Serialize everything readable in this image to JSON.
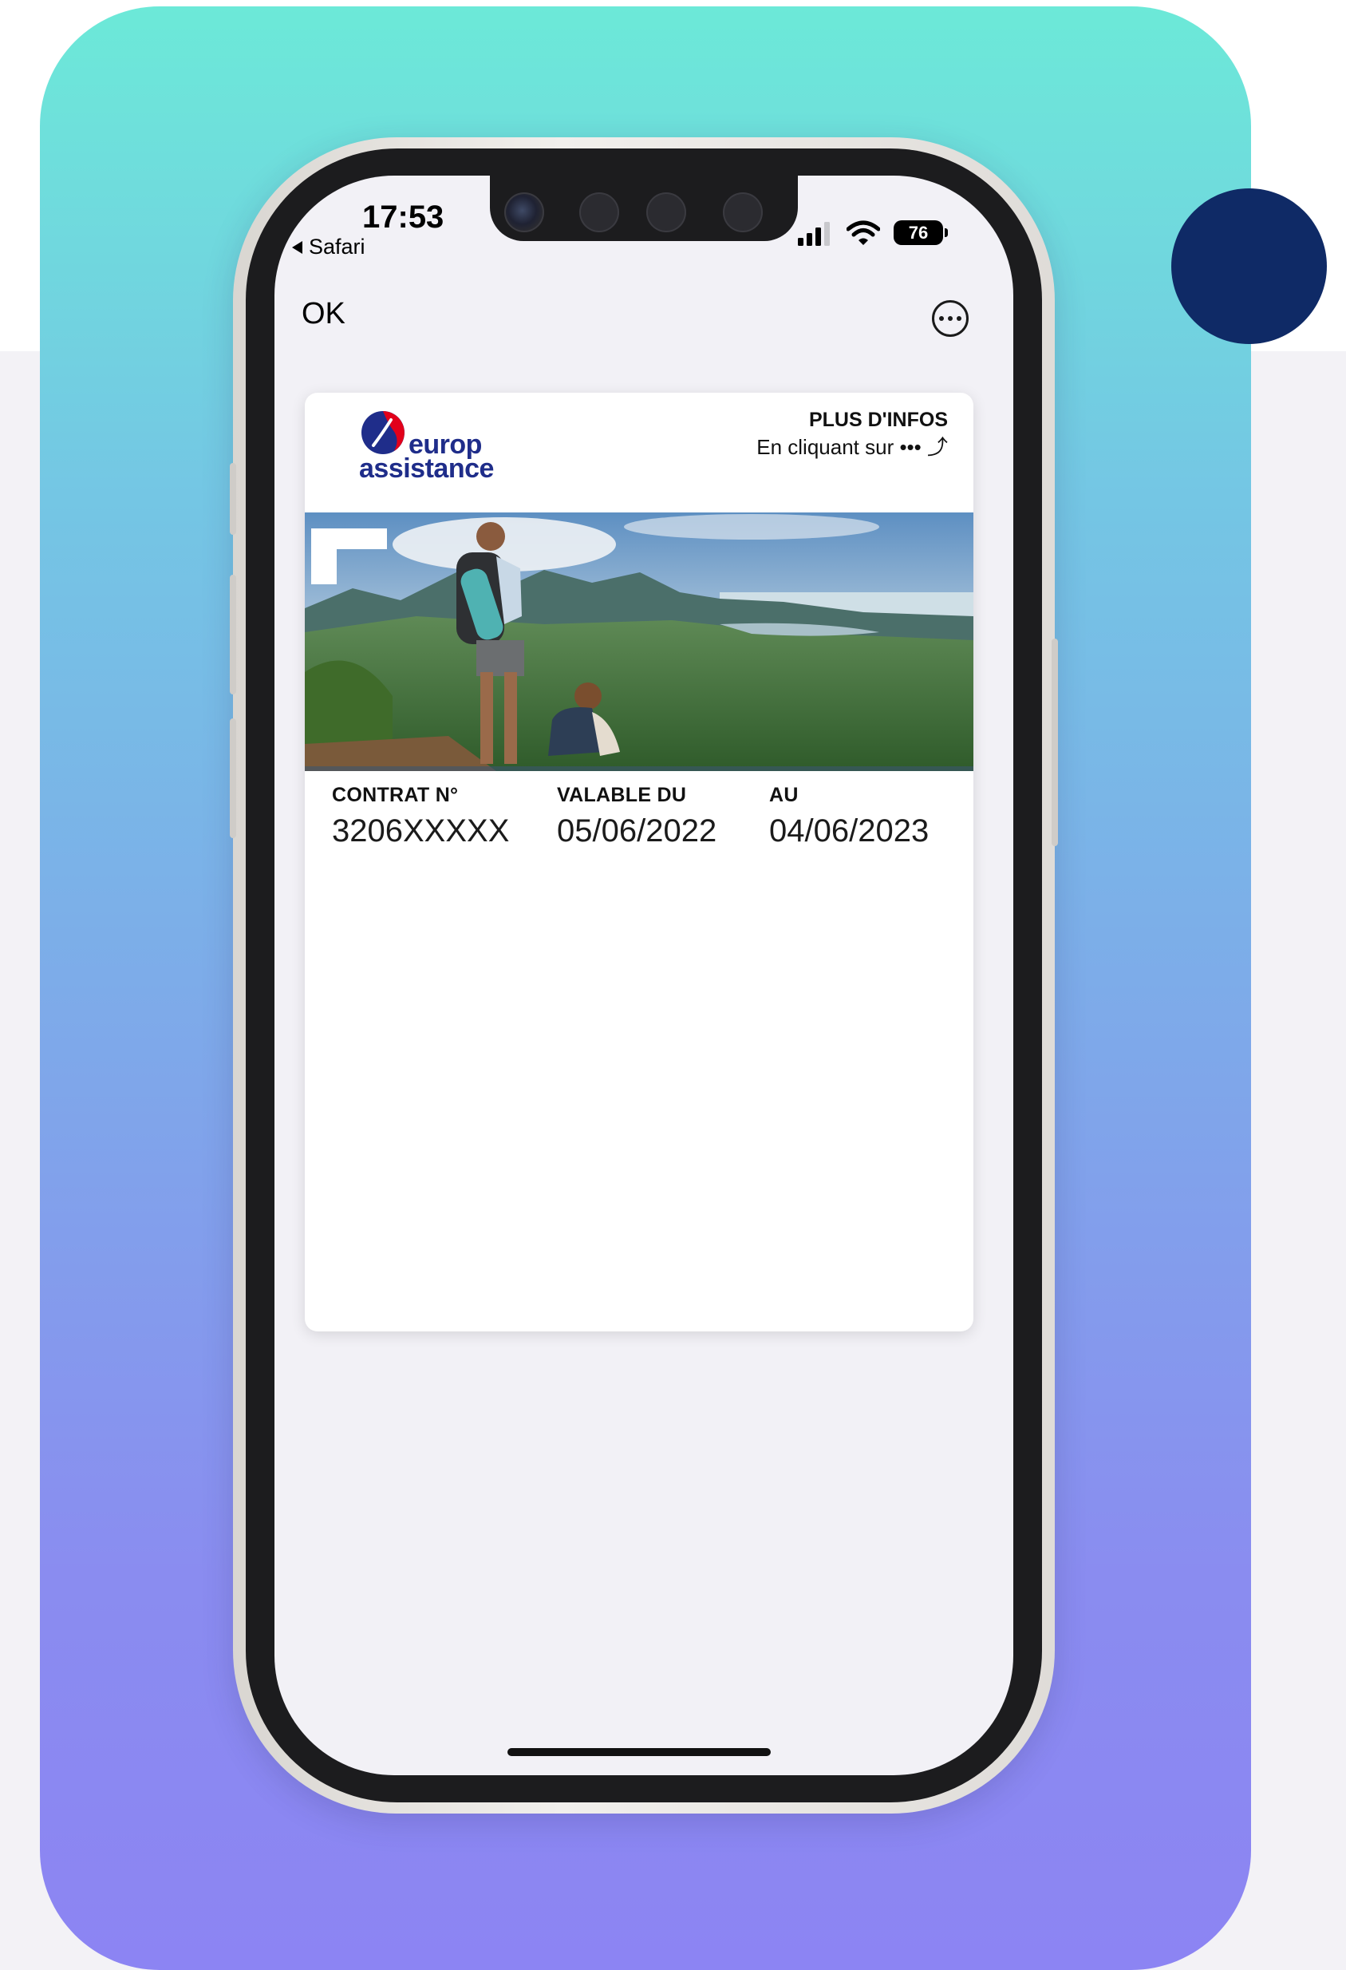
{
  "status_bar": {
    "time": "17:53",
    "back_app": "Safari",
    "battery": "76"
  },
  "nav": {
    "ok_label": "OK"
  },
  "pass": {
    "brand_line1": "europ",
    "brand_line2": "assistance",
    "info_title": "PLUS D'INFOS",
    "info_subtitle": "En cliquant sur ••• ⤴",
    "fields": [
      {
        "label": "CONTRAT N°",
        "value": "3206XXXXX"
      },
      {
        "label": "VALABLE DU",
        "value": "05/06/2022"
      },
      {
        "label": "AU",
        "value": "04/06/2023"
      }
    ]
  },
  "colors": {
    "brand_navy": "#1f2d8a",
    "brand_red": "#e2001a",
    "gradient_top": "#6ce9d8",
    "gradient_bottom": "#8c84f3",
    "accent_dot": "#0f2a66"
  }
}
